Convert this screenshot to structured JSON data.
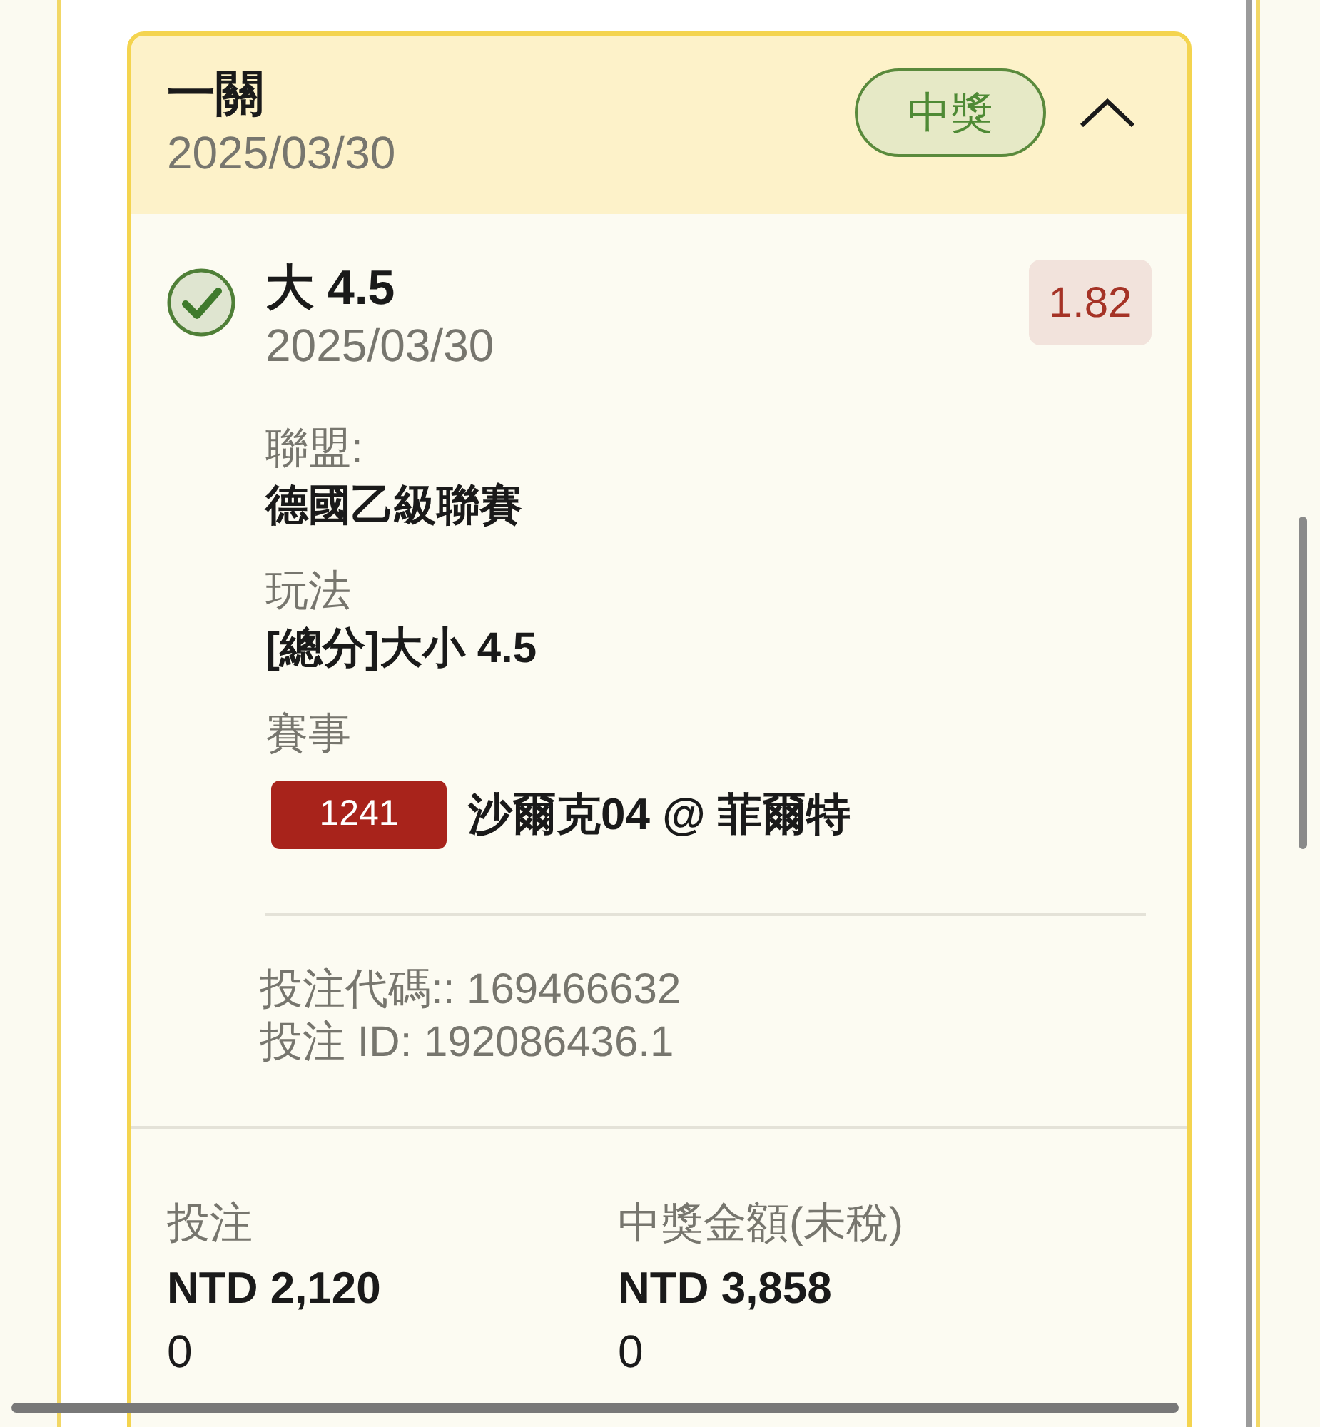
{
  "bet": {
    "title": "一關",
    "date": "2025/03/30",
    "status": "中獎",
    "expanded": true
  },
  "selection": {
    "won": true,
    "pick": "大 4.5",
    "date": "2025/03/30",
    "odds": "1.82",
    "fields": [
      {
        "label": "聯盟:",
        "value": "德國乙級聯賽"
      },
      {
        "label": "玩法",
        "value": "[總分]大小 4.5"
      }
    ],
    "event": {
      "label": "賽事",
      "code": "1241",
      "match": "沙爾克04 @ 菲爾特"
    },
    "refs": [
      "投注代碼:: 169466632",
      "投注 ID: 192086436.1"
    ]
  },
  "summary": [
    {
      "label": "投注",
      "amount": "NTD 2,120",
      "extra": "0"
    },
    {
      "label": "中獎金額(未稅)",
      "amount": "NTD 3,858",
      "extra": "0"
    }
  ]
}
